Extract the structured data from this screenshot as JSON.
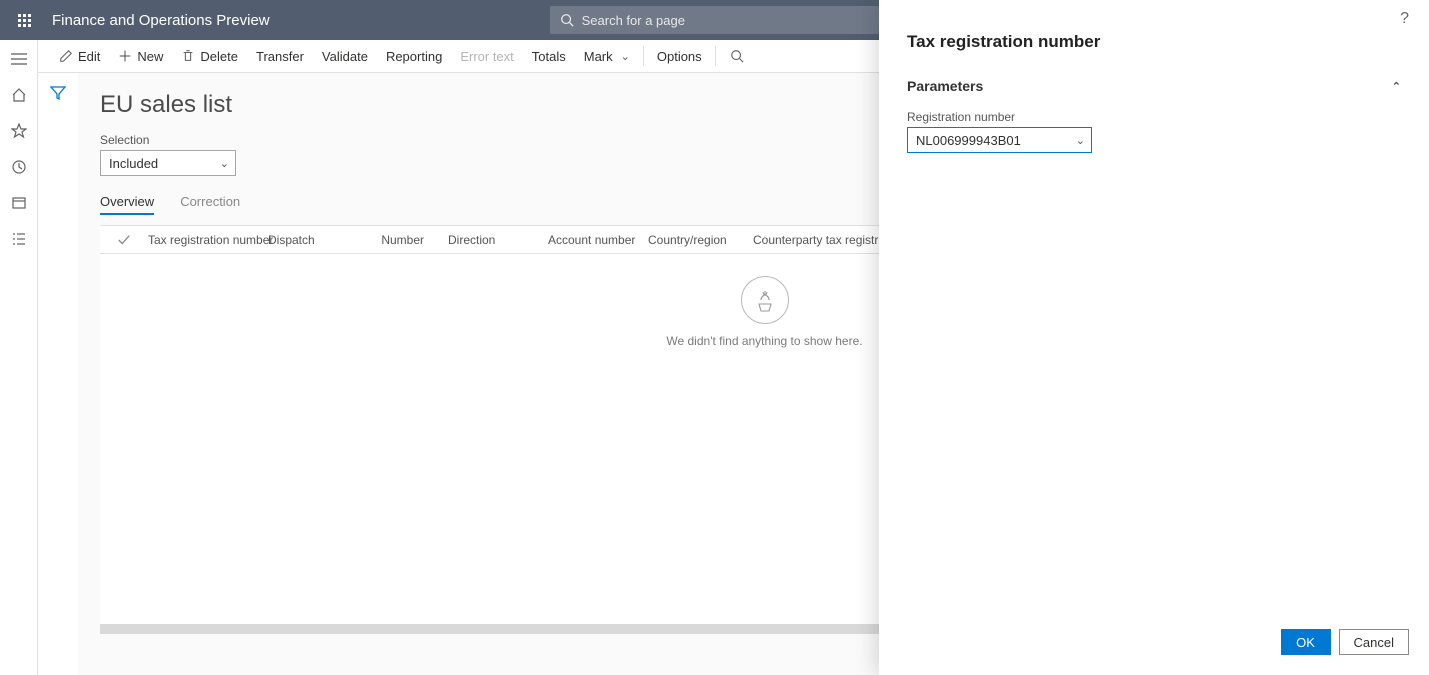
{
  "header": {
    "app_title": "Finance and Operations Preview",
    "search_placeholder": "Search for a page"
  },
  "actions": {
    "edit": "Edit",
    "new": "New",
    "delete": "Delete",
    "transfer": "Transfer",
    "validate": "Validate",
    "reporting": "Reporting",
    "error_text": "Error text",
    "totals": "Totals",
    "mark": "Mark",
    "options": "Options"
  },
  "page": {
    "title": "EU sales list",
    "selection_label": "Selection",
    "selection_value": "Included",
    "tabs": {
      "overview": "Overview",
      "correction": "Correction"
    },
    "columns": {
      "tax_reg": "Tax registration number",
      "dispatch": "Dispatch",
      "number": "Number",
      "direction": "Direction",
      "account": "Account number",
      "country": "Country/region",
      "counterparty": "Counterparty tax registration"
    },
    "empty_text": "We didn't find anything to show here."
  },
  "dialog": {
    "title": "Tax registration number",
    "section": "Parameters",
    "reg_label": "Registration number",
    "reg_value": "NL006999943B01",
    "ok": "OK",
    "cancel": "Cancel"
  }
}
